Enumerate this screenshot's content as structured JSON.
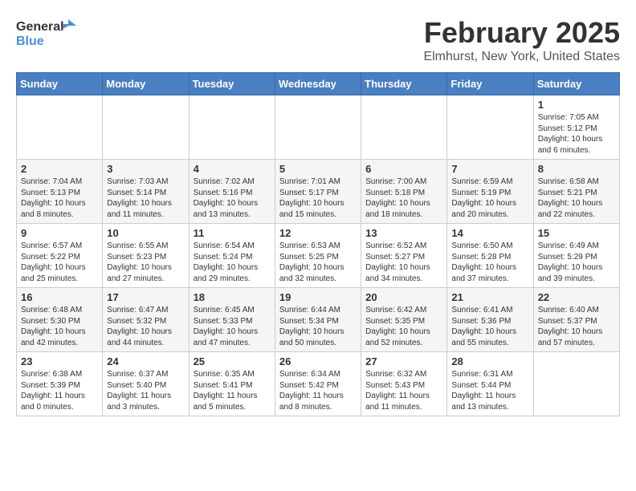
{
  "header": {
    "logo_general": "General",
    "logo_blue": "Blue",
    "month_title": "February 2025",
    "location": "Elmhurst, New York, United States"
  },
  "days_of_week": [
    "Sunday",
    "Monday",
    "Tuesday",
    "Wednesday",
    "Thursday",
    "Friday",
    "Saturday"
  ],
  "weeks": [
    {
      "row_class": "normal-row",
      "days": [
        {
          "number": "",
          "info": ""
        },
        {
          "number": "",
          "info": ""
        },
        {
          "number": "",
          "info": ""
        },
        {
          "number": "",
          "info": ""
        },
        {
          "number": "",
          "info": ""
        },
        {
          "number": "",
          "info": ""
        },
        {
          "number": "1",
          "info": "Sunrise: 7:05 AM\nSunset: 5:12 PM\nDaylight: 10 hours and 6 minutes."
        }
      ]
    },
    {
      "row_class": "alt-row",
      "days": [
        {
          "number": "2",
          "info": "Sunrise: 7:04 AM\nSunset: 5:13 PM\nDaylight: 10 hours and 8 minutes."
        },
        {
          "number": "3",
          "info": "Sunrise: 7:03 AM\nSunset: 5:14 PM\nDaylight: 10 hours and 11 minutes."
        },
        {
          "number": "4",
          "info": "Sunrise: 7:02 AM\nSunset: 5:16 PM\nDaylight: 10 hours and 13 minutes."
        },
        {
          "number": "5",
          "info": "Sunrise: 7:01 AM\nSunset: 5:17 PM\nDaylight: 10 hours and 15 minutes."
        },
        {
          "number": "6",
          "info": "Sunrise: 7:00 AM\nSunset: 5:18 PM\nDaylight: 10 hours and 18 minutes."
        },
        {
          "number": "7",
          "info": "Sunrise: 6:59 AM\nSunset: 5:19 PM\nDaylight: 10 hours and 20 minutes."
        },
        {
          "number": "8",
          "info": "Sunrise: 6:58 AM\nSunset: 5:21 PM\nDaylight: 10 hours and 22 minutes."
        }
      ]
    },
    {
      "row_class": "normal-row",
      "days": [
        {
          "number": "9",
          "info": "Sunrise: 6:57 AM\nSunset: 5:22 PM\nDaylight: 10 hours and 25 minutes."
        },
        {
          "number": "10",
          "info": "Sunrise: 6:55 AM\nSunset: 5:23 PM\nDaylight: 10 hours and 27 minutes."
        },
        {
          "number": "11",
          "info": "Sunrise: 6:54 AM\nSunset: 5:24 PM\nDaylight: 10 hours and 29 minutes."
        },
        {
          "number": "12",
          "info": "Sunrise: 6:53 AM\nSunset: 5:25 PM\nDaylight: 10 hours and 32 minutes."
        },
        {
          "number": "13",
          "info": "Sunrise: 6:52 AM\nSunset: 5:27 PM\nDaylight: 10 hours and 34 minutes."
        },
        {
          "number": "14",
          "info": "Sunrise: 6:50 AM\nSunset: 5:28 PM\nDaylight: 10 hours and 37 minutes."
        },
        {
          "number": "15",
          "info": "Sunrise: 6:49 AM\nSunset: 5:29 PM\nDaylight: 10 hours and 39 minutes."
        }
      ]
    },
    {
      "row_class": "alt-row",
      "days": [
        {
          "number": "16",
          "info": "Sunrise: 6:48 AM\nSunset: 5:30 PM\nDaylight: 10 hours and 42 minutes."
        },
        {
          "number": "17",
          "info": "Sunrise: 6:47 AM\nSunset: 5:32 PM\nDaylight: 10 hours and 44 minutes."
        },
        {
          "number": "18",
          "info": "Sunrise: 6:45 AM\nSunset: 5:33 PM\nDaylight: 10 hours and 47 minutes."
        },
        {
          "number": "19",
          "info": "Sunrise: 6:44 AM\nSunset: 5:34 PM\nDaylight: 10 hours and 50 minutes."
        },
        {
          "number": "20",
          "info": "Sunrise: 6:42 AM\nSunset: 5:35 PM\nDaylight: 10 hours and 52 minutes."
        },
        {
          "number": "21",
          "info": "Sunrise: 6:41 AM\nSunset: 5:36 PM\nDaylight: 10 hours and 55 minutes."
        },
        {
          "number": "22",
          "info": "Sunrise: 6:40 AM\nSunset: 5:37 PM\nDaylight: 10 hours and 57 minutes."
        }
      ]
    },
    {
      "row_class": "normal-row",
      "days": [
        {
          "number": "23",
          "info": "Sunrise: 6:38 AM\nSunset: 5:39 PM\nDaylight: 11 hours and 0 minutes."
        },
        {
          "number": "24",
          "info": "Sunrise: 6:37 AM\nSunset: 5:40 PM\nDaylight: 11 hours and 3 minutes."
        },
        {
          "number": "25",
          "info": "Sunrise: 6:35 AM\nSunset: 5:41 PM\nDaylight: 11 hours and 5 minutes."
        },
        {
          "number": "26",
          "info": "Sunrise: 6:34 AM\nSunset: 5:42 PM\nDaylight: 11 hours and 8 minutes."
        },
        {
          "number": "27",
          "info": "Sunrise: 6:32 AM\nSunset: 5:43 PM\nDaylight: 11 hours and 11 minutes."
        },
        {
          "number": "28",
          "info": "Sunrise: 6:31 AM\nSunset: 5:44 PM\nDaylight: 11 hours and 13 minutes."
        },
        {
          "number": "",
          "info": ""
        }
      ]
    }
  ]
}
